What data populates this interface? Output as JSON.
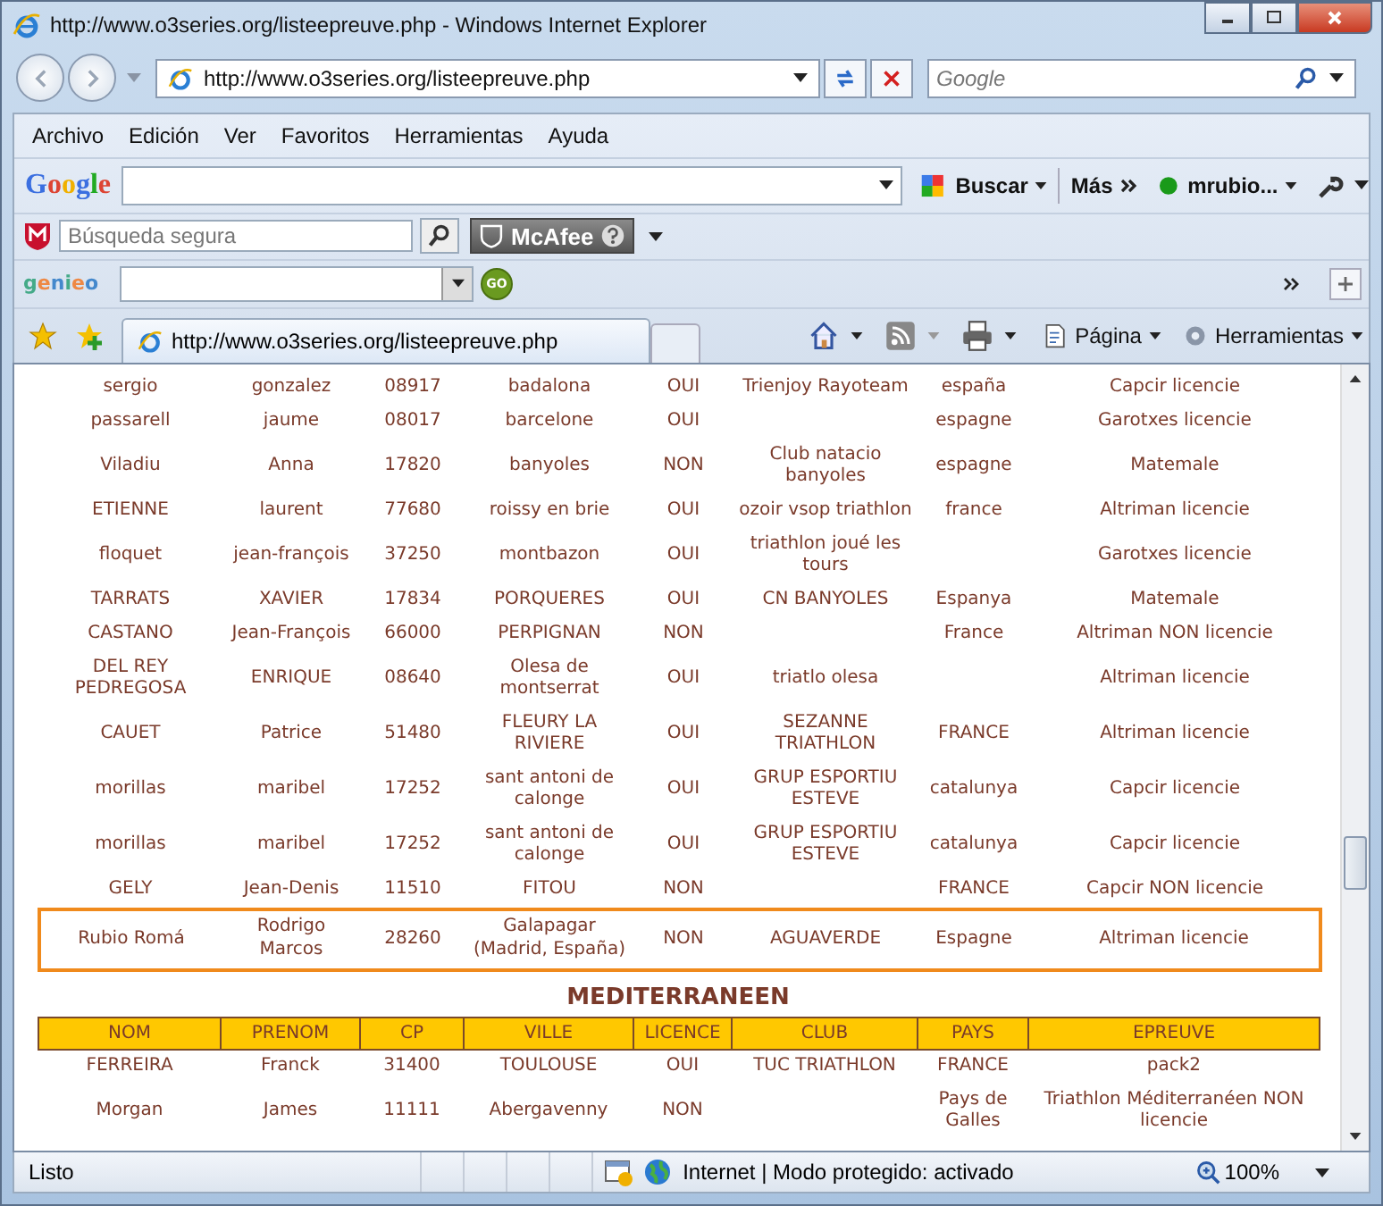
{
  "window": {
    "title": "http://www.o3series.org/listeepreuve.php - Windows Internet Explorer"
  },
  "address_bar": {
    "url": "http://www.o3series.org/listeepreuve.php"
  },
  "search": {
    "placeholder": "Google"
  },
  "menu": [
    "Archivo",
    "Edición",
    "Ver",
    "Favoritos",
    "Herramientas",
    "Ayuda"
  ],
  "google_toolbar": {
    "logo": "Google",
    "search_button": "Buscar",
    "more": "Más",
    "user": "mrubio..."
  },
  "mcafee_toolbar": {
    "placeholder": "Búsqueda segura",
    "brand": "McAfee"
  },
  "genieo_toolbar": {
    "logo": "genieo",
    "go": "GO"
  },
  "tab": {
    "title": "http://www.o3series.org/listeepreuve.php",
    "selected": true
  },
  "command_bar": {
    "page": "Página",
    "tools": "Herramientas"
  },
  "table": {
    "rows": [
      {
        "cells": [
          "sergio",
          "gonzalez",
          "08917",
          "badalona",
          "OUI",
          "Trienjoy Rayoteam",
          "españa",
          "Capcir licencie"
        ],
        "highlighted": false
      },
      {
        "cells": [
          "passarell",
          "jaume",
          "08017",
          "barcelone",
          "OUI",
          "",
          "espagne",
          "Garotxes licencie"
        ],
        "highlighted": false
      },
      {
        "cells": [
          "Viladiu",
          "Anna",
          "17820",
          "banyoles",
          "NON",
          "Club natacio banyoles",
          "espagne",
          "Matemale"
        ],
        "highlighted": false
      },
      {
        "cells": [
          "ETIENNE",
          "laurent",
          "77680",
          "roissy en brie",
          "OUI",
          "ozoir vsop triathlon",
          "france",
          "Altriman licencie"
        ],
        "highlighted": false
      },
      {
        "cells": [
          "floquet",
          "jean-françois",
          "37250",
          "montbazon",
          "OUI",
          "triathlon joué les tours",
          "",
          "Garotxes licencie"
        ],
        "highlighted": false
      },
      {
        "cells": [
          "TARRATS",
          "XAVIER",
          "17834",
          "PORQUERES",
          "OUI",
          "CN BANYOLES",
          "Espanya",
          "Matemale"
        ],
        "highlighted": false
      },
      {
        "cells": [
          "CASTANO",
          "Jean-François",
          "66000",
          "PERPIGNAN",
          "NON",
          "",
          "France",
          "Altriman NON licencie"
        ],
        "highlighted": false
      },
      {
        "cells": [
          "DEL REY PEDREGOSA",
          "ENRIQUE",
          "08640",
          "Olesa de montserrat",
          "OUI",
          "triatlo olesa",
          "",
          "Altriman licencie"
        ],
        "highlighted": false
      },
      {
        "cells": [
          "CAUET",
          "Patrice",
          "51480",
          "FLEURY LA RIVIERE",
          "OUI",
          "SEZANNE TRIATHLON",
          "FRANCE",
          "Altriman licencie"
        ],
        "highlighted": false
      },
      {
        "cells": [
          "morillas",
          "maribel",
          "17252",
          "sant antoni de calonge",
          "OUI",
          "GRUP ESPORTIU ESTEVE",
          "catalunya",
          "Capcir licencie"
        ],
        "highlighted": false
      },
      {
        "cells": [
          "morillas",
          "maribel",
          "17252",
          "sant antoni de calonge",
          "OUI",
          "GRUP ESPORTIU ESTEVE",
          "catalunya",
          "Capcir licencie"
        ],
        "highlighted": false
      },
      {
        "cells": [
          "GELY",
          "Jean-Denis",
          "11510",
          "FITOU",
          "NON",
          "",
          "FRANCE",
          "Capcir NON licencie"
        ],
        "highlighted": false
      },
      {
        "cells": [
          "Rubio Romá",
          "Rodrigo Marcos",
          "28260",
          "Galapagar (Madrid, España)",
          "NON",
          "AGUAVERDE",
          "Espagne",
          "Altriman licencie"
        ],
        "highlighted": true
      }
    ]
  },
  "section": {
    "title": "MEDITERRANEEN",
    "columns": [
      "NOM",
      "PRENOM",
      "CP",
      "VILLE",
      "LICENCE",
      "CLUB",
      "PAYS",
      "EPREUVE"
    ],
    "rows": [
      {
        "cells": [
          "FERREIRA",
          "Franck",
          "31400",
          "TOULOUSE",
          "OUI",
          "TUC TRIATHLON",
          "FRANCE",
          "pack2"
        ],
        "highlighted": false
      },
      {
        "cells": [
          "Morgan",
          "James",
          "11111",
          "Abergavenny",
          "NON",
          "",
          "Pays de Galles",
          "Triathlon Méditerranéen NON licencie"
        ],
        "highlighted": false
      }
    ]
  },
  "status_bar": {
    "text": "Listo",
    "zone": "Internet | Modo protegido: activado",
    "zoom": "100%"
  }
}
